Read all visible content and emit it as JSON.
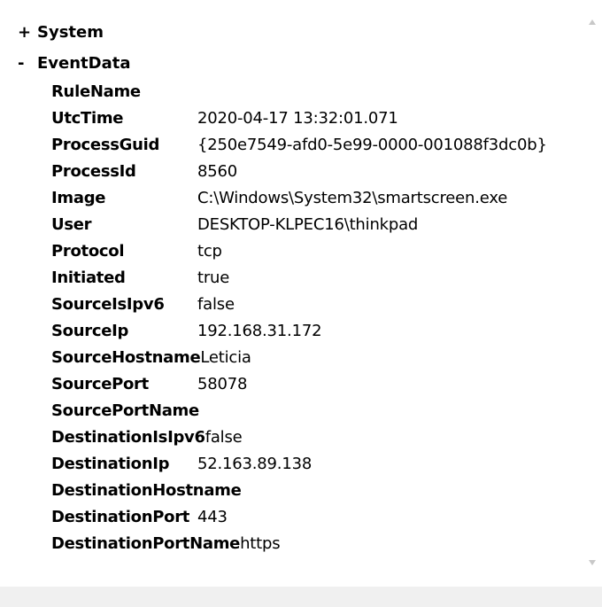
{
  "tree": {
    "system": {
      "toggle": "+",
      "label": "System"
    },
    "eventdata": {
      "toggle": "-",
      "label": "EventData"
    },
    "fields": [
      {
        "key": "RuleName",
        "value": ""
      },
      {
        "key": "UtcTime",
        "value": "2020-04-17 13:32:01.071"
      },
      {
        "key": "ProcessGuid",
        "value": "{250e7549-afd0-5e99-0000-001088f3dc0b}"
      },
      {
        "key": "ProcessId",
        "value": "8560"
      },
      {
        "key": "Image",
        "value": "C:\\Windows\\System32\\smartscreen.exe"
      },
      {
        "key": "User",
        "value": "DESKTOP-KLPEC16\\thinkpad"
      },
      {
        "key": "Protocol",
        "value": "tcp"
      },
      {
        "key": "Initiated",
        "value": "true"
      },
      {
        "key": "SourceIsIpv6",
        "value": "false"
      },
      {
        "key": "SourceIp",
        "value": "192.168.31.172"
      },
      {
        "key": "SourceHostname",
        "value": "Leticia"
      },
      {
        "key": "SourcePort",
        "value": "58078"
      },
      {
        "key": "SourcePortName",
        "value": ""
      },
      {
        "key": "DestinationIsIpv6",
        "value": "false"
      },
      {
        "key": "DestinationIp",
        "value": "52.163.89.138"
      },
      {
        "key": "DestinationHostname",
        "value": ""
      },
      {
        "key": "DestinationPort",
        "value": "443"
      },
      {
        "key": "DestinationPortName",
        "value": "https"
      }
    ]
  }
}
